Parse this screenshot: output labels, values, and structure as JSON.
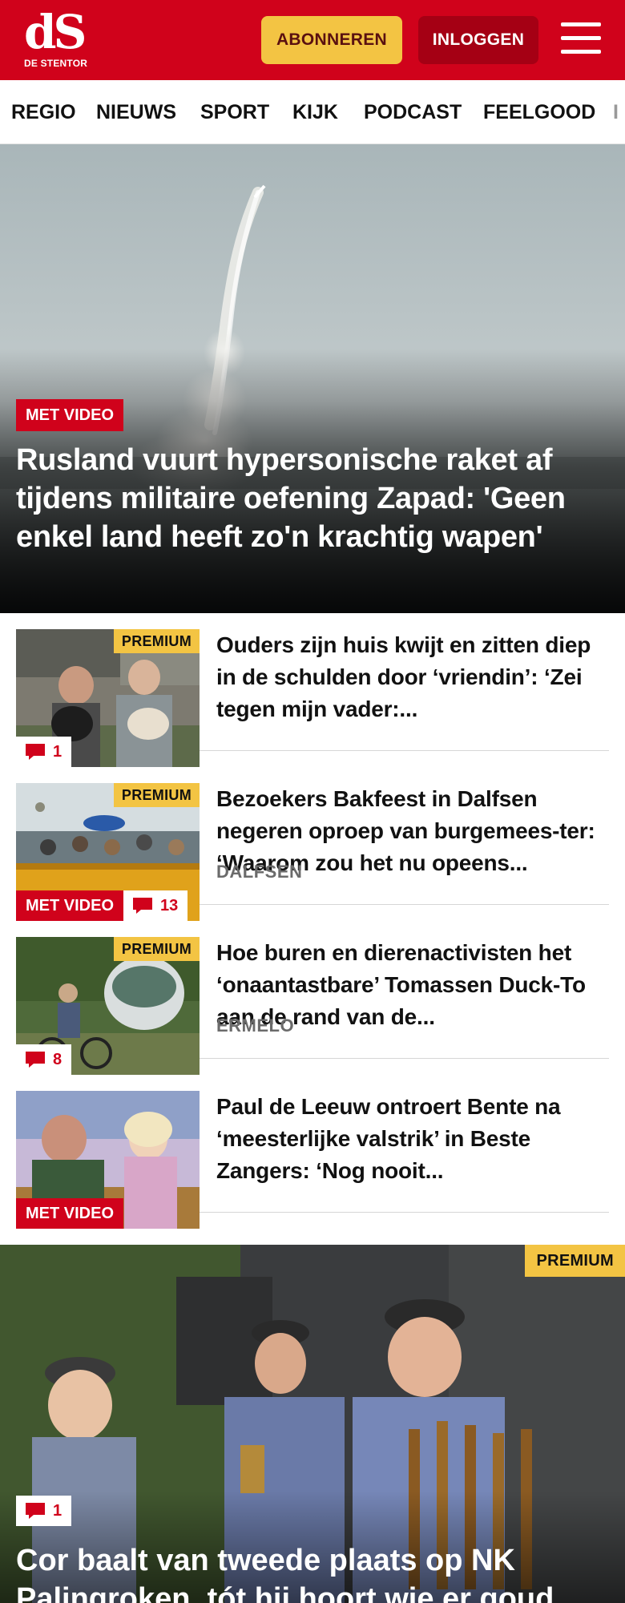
{
  "header": {
    "logo_mark": "dS",
    "logo_sub": "DE STENTOR",
    "subscribe_label": "ABONNEREN",
    "login_label": "INLOGGEN",
    "menu_icon": "hamburger-icon"
  },
  "nav": {
    "items": [
      "REGIO",
      "NIEUWS",
      "SPORT",
      "KIJK",
      "PODCAST",
      "FEELGOOD",
      "I"
    ]
  },
  "hero": {
    "badge": "MET VIDEO",
    "title": "Rusland vuurt hypersonische raket af tijdens militaire oefening Zapad: 'Geen enkel land heeft zo'n krachtig wapen'"
  },
  "articles": [
    {
      "premium": "PREMIUM",
      "video": "",
      "comments": "1",
      "title": "Ouders zijn huis kwijt en zitten diep in de schulden door ‘vriendin’: ‘Zei tegen mijn vader:...",
      "place": ""
    },
    {
      "premium": "PREMIUM",
      "video": "MET VIDEO",
      "comments": "13",
      "title": "Bezoekers Bakfeest in Dalfsen negeren oproep van burgemees-ter: ‘Waarom zou het nu opeens...",
      "place": "DALFSEN"
    },
    {
      "premium": "PREMIUM",
      "video": "",
      "comments": "8",
      "title": "Hoe buren en dierenactivisten het ‘onaantastbare’ Tomassen Duck-To aan de rand van de...",
      "place": "ERMELO"
    },
    {
      "premium": "",
      "video": "MET VIDEO",
      "comments": "",
      "title": "Paul de Leeuw ontroert Bente na ‘meesterlijke valstrik’ in Beste Zangers: ‘Nog nooit...",
      "place": ""
    }
  ],
  "feature": {
    "premium": "PREMIUM",
    "comments": "1",
    "title": "Cor baalt van tweede plaats op NK Palingroken, tót hij hoort wie er goud"
  },
  "colors": {
    "brand_red": "#d0021b",
    "premium_yellow": "#f3c443",
    "login_dark_red": "#a50014"
  }
}
